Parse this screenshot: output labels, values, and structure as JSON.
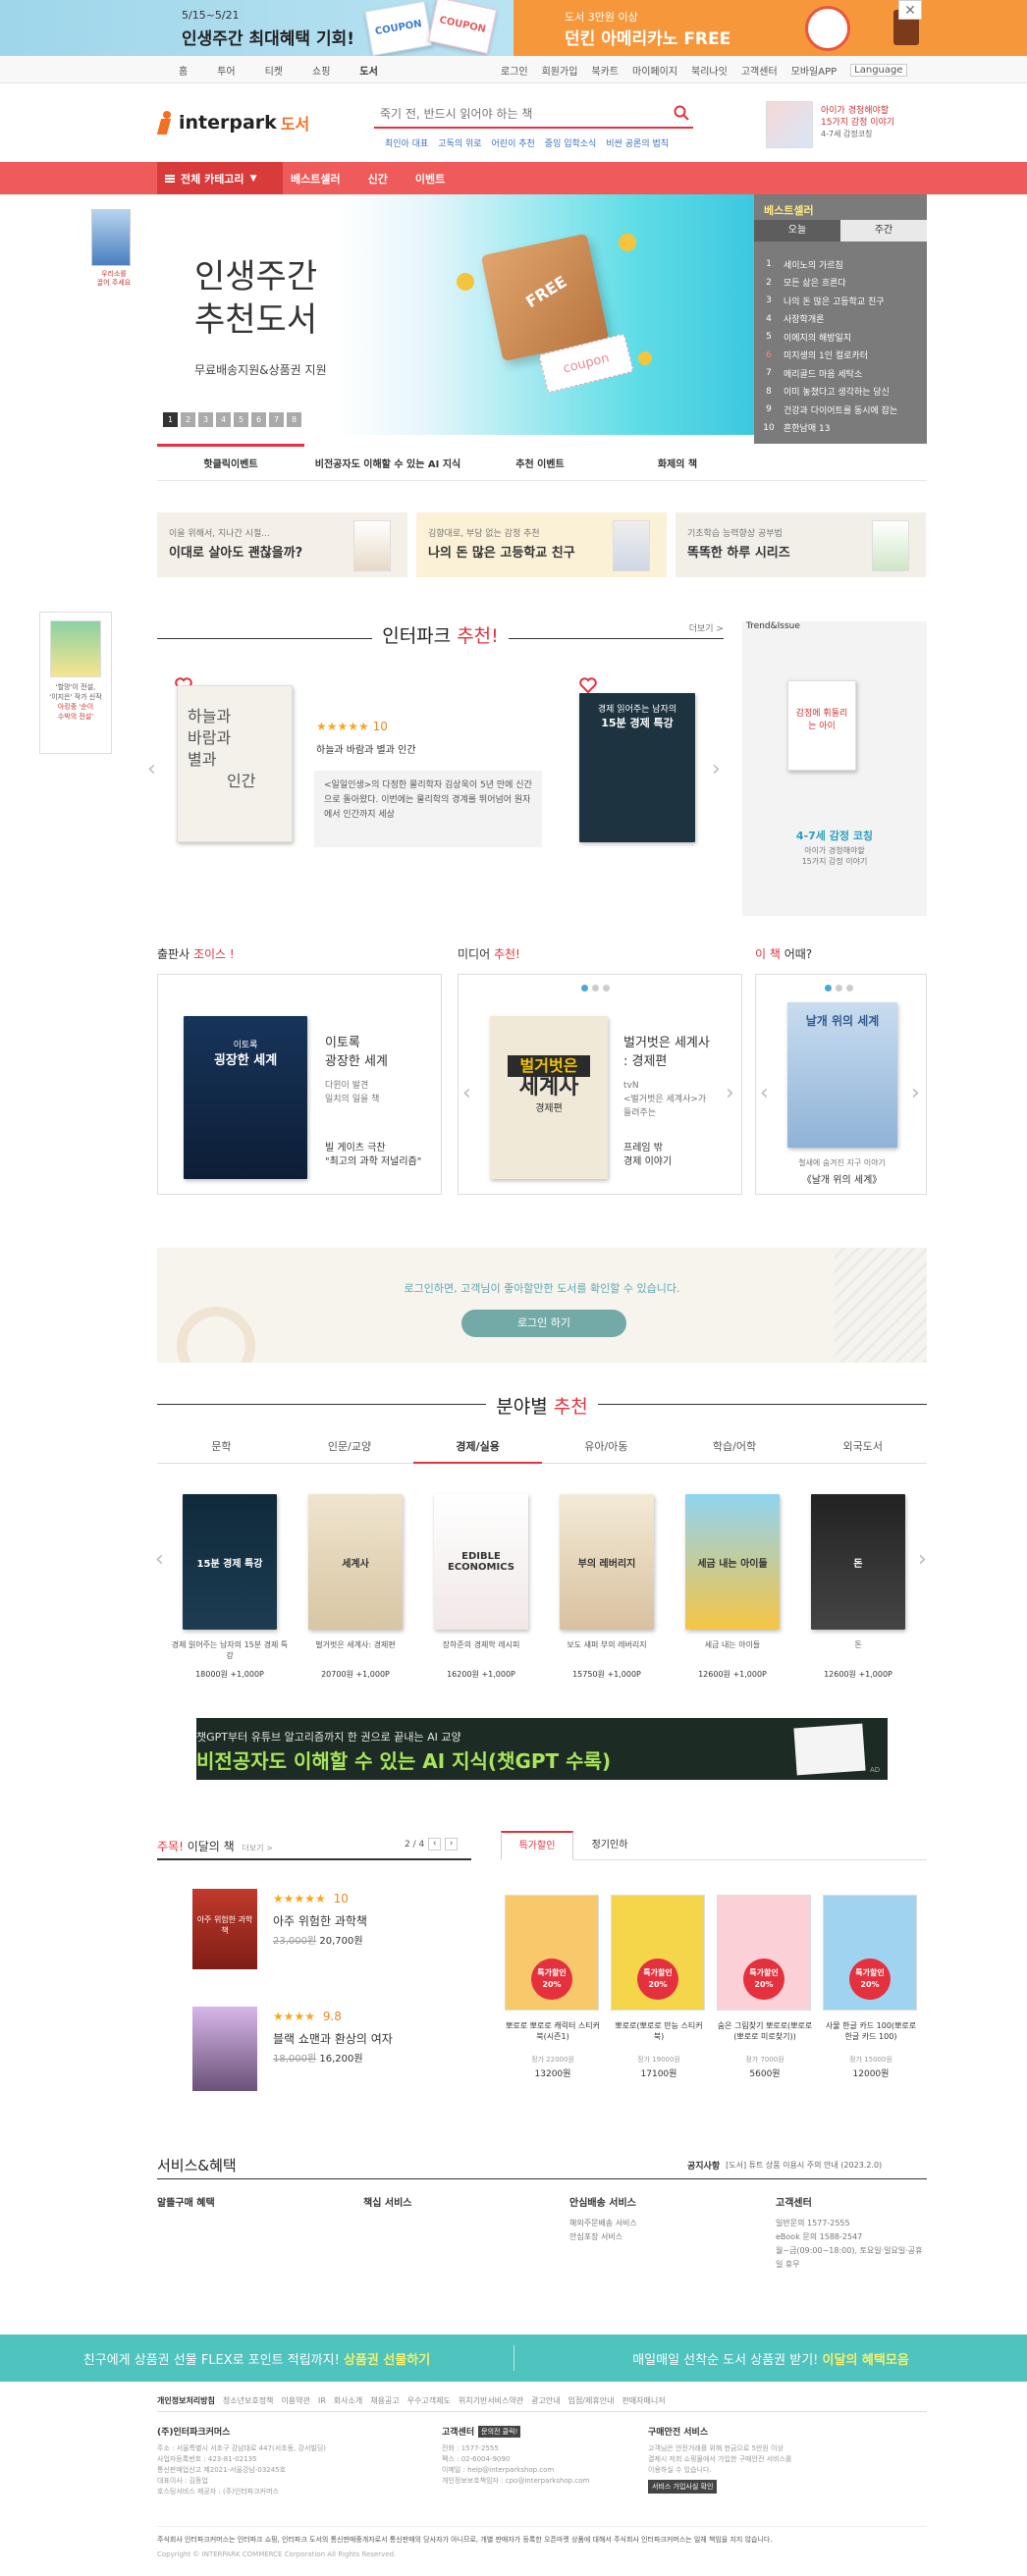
{
  "topbanner": {
    "left_date": "5/15~5/21",
    "left_title": "인생주간 최대혜택 기회!",
    "coupon1": "COUPON",
    "coupon2": "COUPON",
    "right_small": "도서 3만원 이상",
    "right_title": "던킨 아메리카노 FREE",
    "close": "✕"
  },
  "gnb": {
    "left": [
      "홈",
      "투어",
      "티켓",
      "쇼핑",
      "도서"
    ],
    "right": [
      "로그인",
      "회원가입",
      "북카트",
      "마이페이지",
      "북리나잇",
      "고객센터",
      "모바일APP",
      "Language"
    ]
  },
  "header": {
    "logo": "interpark",
    "logo_sub": "도서",
    "search_placeholder": "죽기 전, 반드시 읽어야 하는 책",
    "keywords": [
      "최인아 대표",
      "고독의 위로",
      "어린이 추천",
      "중잉 입학소식",
      "비싼 공론의 법칙"
    ],
    "ad_title": "아이가 경청해야할",
    "ad_sub": "15가지 감정 이야기",
    "ad_tag": "4-7세 감정코칭"
  },
  "nav": {
    "category": "전체 카테고리",
    "items": [
      "베스트셀러",
      "신간",
      "이벤트"
    ]
  },
  "hero": {
    "title1": "인생주간",
    "title2": "추천도서",
    "sub": "무료배송지원&상품권 지원",
    "dots": [
      "1",
      "2",
      "3",
      "4",
      "5",
      "6",
      "7",
      "8"
    ],
    "tabs": [
      "핫클릭이벤트",
      "비전공자도 이해할 수 있는 AI 지식",
      "추천 이벤트",
      "화제의 책"
    ],
    "free": "FREE",
    "coupon": "coupon"
  },
  "side_left": {
    "label1": "우리소를",
    "label2": "끌어 주세요",
    "pill_label1": "'할망'이 전설,",
    "pill_label2": "'이지은' 작가 신작",
    "pill_label3": "아킹중 '순이",
    "pill_label4": "수박의 전설'"
  },
  "bestseller": {
    "title": "베스트셀러",
    "tabs": [
      "오늘",
      "주간"
    ],
    "items": [
      {
        "rank": "1",
        "title": "세이노의 가르침"
      },
      {
        "rank": "2",
        "title": "모든 삶은 흐른다"
      },
      {
        "rank": "3",
        "title": "나의 돈 많은 고등학교 친구"
      },
      {
        "rank": "4",
        "title": "사장학개론"
      },
      {
        "rank": "5",
        "title": "이에지의 해방일지"
      },
      {
        "rank": "6",
        "title": "미지생의 1인 컬로카터"
      },
      {
        "rank": "7",
        "title": "메리골드 마음 세탁소"
      },
      {
        "rank": "8",
        "title": "이미 놓쳤다고 생각하는 당신"
      },
      {
        "rank": "9",
        "title": "건강과 다이어트를 동시에 잡는"
      },
      {
        "rank": "10",
        "title": "흔한남매 13"
      }
    ]
  },
  "promos": [
    {
      "small": "이을 위해서, 지나간 시절...",
      "title": "이대로 살아도 괜찮을까?"
    },
    {
      "small": "김향대로, 부담 없는 감정 추천",
      "title": "나의 돈 많은 고등학교 친구"
    },
    {
      "small": "기초학습 능력향상 공부법",
      "title": "똑똑한 하루 시리즈"
    }
  ],
  "recommend": {
    "title_prefix": "인터파크 ",
    "title_accent": "추천!",
    "more": "더보기 >",
    "book_title": "하늘과 바람과 별과 인간",
    "cover_text1": "하늘과",
    "cover_text2": "바람과",
    "cover_text3": "별과",
    "cover_text4": "인간",
    "rating": "10",
    "stars": "★★★★★",
    "desc": "<일일인생>의 다정한 물리학자 김상욱이 5년 만에 신간으로 돌아왔다. 이번에는 물리학의 경계를 뛰어넘어 원자에서 인간까지 세상",
    "book2_title1": "경제 읽어주는 남자의",
    "book2_title2": "15분 경제 특강"
  },
  "trend": {
    "title": "Trend&Issue",
    "book_text": "감정에 휘둘리는 아이",
    "caption": "4-7세 감정 코칭",
    "caption2": "아이가 경청해야할",
    "caption3": "15가지 감정 이야기"
  },
  "cards": [
    {
      "head_prefix": "출판사 ",
      "head_accent": "조이스 !",
      "title1": "이토록",
      "title2": "광장한 세계",
      "sub1": "다윈이 발견",
      "sub2": "일치의 일을 책",
      "foot1": "빌 게이츠 극찬",
      "foot2": "\"최고의 과학 저널리즘\"",
      "cover1": "이토록",
      "cover2": "굉장한 세계"
    },
    {
      "head_prefix": "미디어 ",
      "head_accent": "추천!",
      "title1": "벌거벗은 세계사",
      "title2": ": 경제편",
      "sub1": "tvN",
      "sub2": "<벌거벗은 세계사>가",
      "sub3": "들려주는",
      "foot1": "프레임 밖",
      "foot2": "경제 이야기",
      "cover1": "벌거벗은",
      "cover2": "세계사",
      "cover3": "경제편"
    },
    {
      "head_accent": "이 책",
      "head_suffix": " 어때?",
      "cover1": "날개 위의 세계",
      "cap1": "철새에 숨겨진 지구 이야기",
      "cap2": "《날개 위의 세계》"
    }
  ],
  "login_box": {
    "text": "로그인하면, 고객님이 좋아할만한 도서를 확인할 수 있습니다.",
    "button": "로그인 하기"
  },
  "field": {
    "title_prefix": "분야별 ",
    "title_accent": "추천",
    "tabs": [
      "문학",
      "인문/교양",
      "경제/실용",
      "유아/아동",
      "학습/어학",
      "외국도서"
    ],
    "active_index": 2,
    "books": [
      {
        "title": "경제 읽어주는 남자의 15분 경제 특강",
        "price": "18000원 +1,000P",
        "cover": "15분 경제 특강"
      },
      {
        "title": "벌거벗은 세계사: 경제편",
        "price": "20700원 +1,000P",
        "cover": "세계사"
      },
      {
        "title": "장하준의 경제학 레시피",
        "price": "16200원 +1,000P",
        "cover": "EDIBLE ECONOMICS"
      },
      {
        "title": "보도 섀퍼 부의 레버리지",
        "price": "15750원 +1,000P",
        "cover": "부의 레버리지"
      },
      {
        "title": "세금 내는 아이들",
        "price": "12600원 +1,000P",
        "cover": "세금 내는 아이들"
      },
      {
        "title": "돈",
        "price": "12600원 +1,000P",
        "cover": "돈"
      }
    ]
  },
  "ai_banner": {
    "small": "챗GPT부터 유튜브 알고리즘까지 한 권으로 끝내는 AI 교양",
    "title": "비전공자도 이해할 수 있는 AI 지식(챗GPT 수록)",
    "ad": "AD"
  },
  "monthly": {
    "title_accent": "주목!",
    "title": " 이달의 책",
    "more": "더보기 >",
    "page": "2 / 4",
    "books": [
      {
        "title": "아주 위험한 과학책",
        "orig": "23,000원",
        "price": "20,700원",
        "rating": "10",
        "stars": "★★★★★",
        "cover": "아주 위험한 과학책"
      },
      {
        "title": "블랙 쇼맨과 환상의 여자",
        "orig": "18,000원",
        "price": "16,200원",
        "rating": "9.8",
        "stars": "★★★★",
        "cover": ""
      }
    ]
  },
  "sale": {
    "tabs": [
      "특가할인",
      "정기인하"
    ],
    "badge": "특가할인 20%",
    "items": [
      {
        "title": "뽀로로 뽀로로 캐릭터 스티커북(시즌1)",
        "orig": "정가 22000원",
        "price": "13200원"
      },
      {
        "title": "뽀로로(뽀로로 만능 스티커북)",
        "orig": "정가 19000원",
        "price": "17100원"
      },
      {
        "title": "숨은 그림찾기 뽀로로(뽀로로(뽀로로 미로찾기))",
        "orig": "정가 7000원",
        "price": "5600원"
      },
      {
        "title": "사물 한글 카드 100(뽀로로 한글 카드 100)",
        "orig": "정가 15000원",
        "price": "12000원"
      }
    ]
  },
  "service": {
    "title": "서비스&혜택",
    "notice_label": "공지사항",
    "notice": "[도서] 튜트 상품 이용시 주의 안내 (2023.2.0)",
    "cols": [
      {
        "head": "알뜰구매 혜택",
        "items": []
      },
      {
        "head": "책십 서비스",
        "items": []
      },
      {
        "head": "안심배송 서비스",
        "items": [
          "해외주문배송 서비스",
          "안심포장 서비스"
        ]
      },
      {
        "head": "고객센터",
        "items": [
          "일반문의 1577-2555",
          "eBook 문의 1588-2547",
          "월~금(09:00~18:00), 토요일·일요일·공휴일 휴무"
        ]
      }
    ]
  },
  "bottom_banner": {
    "left": "친구에게 상품권 선물 FLEX로 포인트 적립까지! ",
    "left_accent": "상품권 선물하기",
    "right": "매일매일 선착순 도서 상품권 받기! ",
    "right_accent": "이달의 혜택모음"
  },
  "footer": {
    "links": [
      "개인정보처리방침",
      "청소년보호정책",
      "이용약관",
      "IR",
      "회사소개",
      "채용공고",
      "우수고객제도",
      "위치기반서비스약관",
      "광고안내",
      "입점/제휴안내",
      "판매자매니저"
    ],
    "company": "(주)인터파크커머스",
    "addr": [
      "주소 : 서울특별시 서초구 강남대로 447(서초동, 강서빌딩)",
      "사업자등록번호 : 423-81-02135",
      "통신판매업신고 제2021-서울강남-03245호",
      "대표이사 : 김동업",
      "호스팅서비스 제공자 : (주)인터파크커머스"
    ],
    "cs_title": "고객센터",
    "cs_badge": "문의전 클릭!",
    "cs": [
      "전화 : 1577-2555",
      "팩스 : 02-6004-9090",
      "이메일 : help@interparkshop.com",
      "개인정보보호책임자 : cpo@interparkshop.com"
    ],
    "safe_title": "구매안전 서비스",
    "safe": [
      "고객님은 안전거래를 위해 현금으로 5만원 이상",
      "결제시 저희 쇼핑몰에서 가입한 구매안전 서비스를",
      "이용하실 수 있습니다."
    ],
    "safe_btn": "서비스 가입사실 확인",
    "disclaimer": "주식회사 인터파크커머스는 인터파크 쇼핑, 인터파크 도서의 통신판매중개자로서 통신판매의 당사자가 아니므로, 개별 판매자가 등록한 오픈마켓 상품에 대해서 주식회사 인터파크커머스는 일체 책임을 지지 않습니다.",
    "copyright": "Copyright © INTERPARK COMMERCE Corporation All Rights Reserved."
  }
}
